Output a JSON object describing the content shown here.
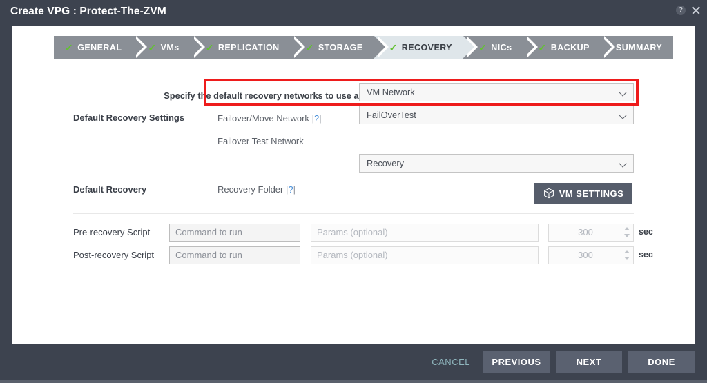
{
  "window": {
    "title": "Create VPG : Protect-The-ZVM",
    "help_icon": "help-circle-icon",
    "help_glyph": "?",
    "close_icon": "close-icon"
  },
  "wizard": {
    "steps": [
      {
        "label": "GENERAL",
        "done": true,
        "active": false
      },
      {
        "label": "VMs",
        "done": true,
        "active": false
      },
      {
        "label": "REPLICATION",
        "done": true,
        "active": false
      },
      {
        "label": "STORAGE",
        "done": true,
        "active": false
      },
      {
        "label": "RECOVERY",
        "done": true,
        "active": true
      },
      {
        "label": "NICs",
        "done": true,
        "active": false
      },
      {
        "label": "BACKUP",
        "done": true,
        "active": false
      },
      {
        "label": "SUMMARY",
        "done": false,
        "active": false
      }
    ],
    "check_glyph": "✓",
    "active_step": "RECOVERY"
  },
  "instruction": "Specify the default recovery networks to use and the scripts to run as part of the recovery.",
  "form": {
    "section_recovery_settings": {
      "heading": "Default Recovery Settings",
      "rows": [
        {
          "label": "Failover/Move Network",
          "help": "?",
          "bar": "|",
          "value": "VM Network",
          "highlighted": true
        },
        {
          "label": "Failover Test Network",
          "help": "",
          "bar": "",
          "value": "FailOverTest",
          "highlighted": false
        }
      ]
    },
    "section_default_recovery": {
      "heading": "Default Recovery",
      "rows": [
        {
          "label": "Recovery Folder",
          "help": "?",
          "bar": "|",
          "value": "Recovery"
        }
      ],
      "vm_settings_button": "VM SETTINGS",
      "vm_settings_icon": "cube-icon"
    },
    "section_scripts": {
      "rows": [
        {
          "label": "Pre-recovery Script",
          "command_placeholder": "Command to run",
          "command_value": "",
          "params_placeholder": "Params (optional)",
          "params_value": "",
          "timeout_value": "300",
          "timeout_unit": "sec"
        },
        {
          "label": "Post-recovery Script",
          "command_placeholder": "Command to run",
          "command_value": "",
          "params_placeholder": "Params (optional)",
          "params_value": "",
          "timeout_value": "300",
          "timeout_unit": "sec"
        }
      ]
    }
  },
  "annotation": {
    "highlight_color": "#ee1c1c",
    "target": "Failover/Move Network row"
  },
  "footer": {
    "cancel": "CANCEL",
    "previous": "PREVIOUS",
    "next": "NEXT",
    "done": "DONE"
  },
  "colors": {
    "chrome": "#3d434f",
    "panel": "#ffffff",
    "step_inactive": "#8a8f96",
    "step_active": "#dfe6ea",
    "check_green": "#63c132",
    "button": "#5a6170",
    "link": "#8fb6bd",
    "help_link": "#4a90d9",
    "highlight": "#ee1c1c"
  }
}
